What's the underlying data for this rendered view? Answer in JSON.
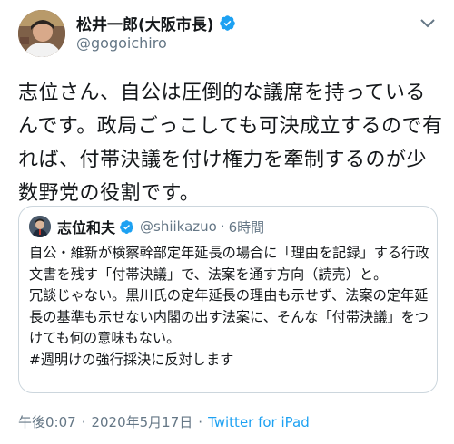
{
  "author": {
    "display_name": "松井一郎(大阪市長)",
    "handle": "@gogoichiro"
  },
  "tweet": {
    "text": "志位さん、自公は圧倒的な議席を持っているんです。政局ごっこしても可決成立するので有れば、付帯決議を付け権力を牽制するのが少数野党の役割です。"
  },
  "quoted_tweet": {
    "display_name": "志位和夫",
    "handle": "@shiikazuo",
    "separator": "·",
    "time": "6時間",
    "text": "自公・維新が検察幹部定年延長の場合に「理由を記録」する行政文書を残す「付帯決議」で、法案を通す方向（読売）と。\n冗談じゃない。黒川氏の定年延長の理由も示せず、法案の定年延長の基準も示せない内閣の出す法案に、そんな「付帯決議」をつけても何の意味もない。\n#週明けの強行採決に反対します"
  },
  "meta": {
    "time": "午後0:07",
    "separator_1": "·",
    "date": "2020年5月17日",
    "separator_2": "·",
    "source": "Twitter for iPad"
  },
  "colors": {
    "accent": "#1da1f2",
    "secondary_text": "#657786",
    "border": "#ccd6dd"
  },
  "icons": {
    "verified": "verified-badge-icon",
    "menu": "chevron-down-icon"
  }
}
